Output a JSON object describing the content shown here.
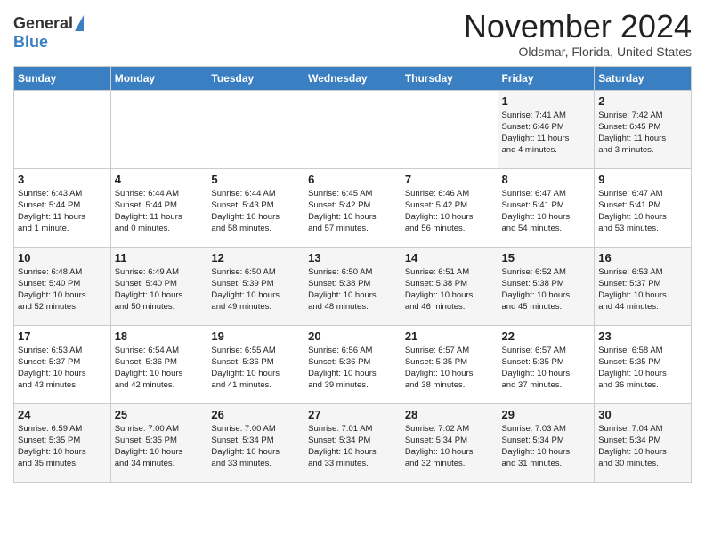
{
  "logo": {
    "general": "General",
    "blue": "Blue"
  },
  "title": "November 2024",
  "location": "Oldsmar, Florida, United States",
  "weekdays": [
    "Sunday",
    "Monday",
    "Tuesday",
    "Wednesday",
    "Thursday",
    "Friday",
    "Saturday"
  ],
  "weeks": [
    [
      {
        "day": "",
        "info": ""
      },
      {
        "day": "",
        "info": ""
      },
      {
        "day": "",
        "info": ""
      },
      {
        "day": "",
        "info": ""
      },
      {
        "day": "",
        "info": ""
      },
      {
        "day": "1",
        "info": "Sunrise: 7:41 AM\nSunset: 6:46 PM\nDaylight: 11 hours\nand 4 minutes."
      },
      {
        "day": "2",
        "info": "Sunrise: 7:42 AM\nSunset: 6:45 PM\nDaylight: 11 hours\nand 3 minutes."
      }
    ],
    [
      {
        "day": "3",
        "info": "Sunrise: 6:43 AM\nSunset: 5:44 PM\nDaylight: 11 hours\nand 1 minute."
      },
      {
        "day": "4",
        "info": "Sunrise: 6:44 AM\nSunset: 5:44 PM\nDaylight: 11 hours\nand 0 minutes."
      },
      {
        "day": "5",
        "info": "Sunrise: 6:44 AM\nSunset: 5:43 PM\nDaylight: 10 hours\nand 58 minutes."
      },
      {
        "day": "6",
        "info": "Sunrise: 6:45 AM\nSunset: 5:42 PM\nDaylight: 10 hours\nand 57 minutes."
      },
      {
        "day": "7",
        "info": "Sunrise: 6:46 AM\nSunset: 5:42 PM\nDaylight: 10 hours\nand 56 minutes."
      },
      {
        "day": "8",
        "info": "Sunrise: 6:47 AM\nSunset: 5:41 PM\nDaylight: 10 hours\nand 54 minutes."
      },
      {
        "day": "9",
        "info": "Sunrise: 6:47 AM\nSunset: 5:41 PM\nDaylight: 10 hours\nand 53 minutes."
      }
    ],
    [
      {
        "day": "10",
        "info": "Sunrise: 6:48 AM\nSunset: 5:40 PM\nDaylight: 10 hours\nand 52 minutes."
      },
      {
        "day": "11",
        "info": "Sunrise: 6:49 AM\nSunset: 5:40 PM\nDaylight: 10 hours\nand 50 minutes."
      },
      {
        "day": "12",
        "info": "Sunrise: 6:50 AM\nSunset: 5:39 PM\nDaylight: 10 hours\nand 49 minutes."
      },
      {
        "day": "13",
        "info": "Sunrise: 6:50 AM\nSunset: 5:38 PM\nDaylight: 10 hours\nand 48 minutes."
      },
      {
        "day": "14",
        "info": "Sunrise: 6:51 AM\nSunset: 5:38 PM\nDaylight: 10 hours\nand 46 minutes."
      },
      {
        "day": "15",
        "info": "Sunrise: 6:52 AM\nSunset: 5:38 PM\nDaylight: 10 hours\nand 45 minutes."
      },
      {
        "day": "16",
        "info": "Sunrise: 6:53 AM\nSunset: 5:37 PM\nDaylight: 10 hours\nand 44 minutes."
      }
    ],
    [
      {
        "day": "17",
        "info": "Sunrise: 6:53 AM\nSunset: 5:37 PM\nDaylight: 10 hours\nand 43 minutes."
      },
      {
        "day": "18",
        "info": "Sunrise: 6:54 AM\nSunset: 5:36 PM\nDaylight: 10 hours\nand 42 minutes."
      },
      {
        "day": "19",
        "info": "Sunrise: 6:55 AM\nSunset: 5:36 PM\nDaylight: 10 hours\nand 41 minutes."
      },
      {
        "day": "20",
        "info": "Sunrise: 6:56 AM\nSunset: 5:36 PM\nDaylight: 10 hours\nand 39 minutes."
      },
      {
        "day": "21",
        "info": "Sunrise: 6:57 AM\nSunset: 5:35 PM\nDaylight: 10 hours\nand 38 minutes."
      },
      {
        "day": "22",
        "info": "Sunrise: 6:57 AM\nSunset: 5:35 PM\nDaylight: 10 hours\nand 37 minutes."
      },
      {
        "day": "23",
        "info": "Sunrise: 6:58 AM\nSunset: 5:35 PM\nDaylight: 10 hours\nand 36 minutes."
      }
    ],
    [
      {
        "day": "24",
        "info": "Sunrise: 6:59 AM\nSunset: 5:35 PM\nDaylight: 10 hours\nand 35 minutes."
      },
      {
        "day": "25",
        "info": "Sunrise: 7:00 AM\nSunset: 5:35 PM\nDaylight: 10 hours\nand 34 minutes."
      },
      {
        "day": "26",
        "info": "Sunrise: 7:00 AM\nSunset: 5:34 PM\nDaylight: 10 hours\nand 33 minutes."
      },
      {
        "day": "27",
        "info": "Sunrise: 7:01 AM\nSunset: 5:34 PM\nDaylight: 10 hours\nand 33 minutes."
      },
      {
        "day": "28",
        "info": "Sunrise: 7:02 AM\nSunset: 5:34 PM\nDaylight: 10 hours\nand 32 minutes."
      },
      {
        "day": "29",
        "info": "Sunrise: 7:03 AM\nSunset: 5:34 PM\nDaylight: 10 hours\nand 31 minutes."
      },
      {
        "day": "30",
        "info": "Sunrise: 7:04 AM\nSunset: 5:34 PM\nDaylight: 10 hours\nand 30 minutes."
      }
    ]
  ]
}
